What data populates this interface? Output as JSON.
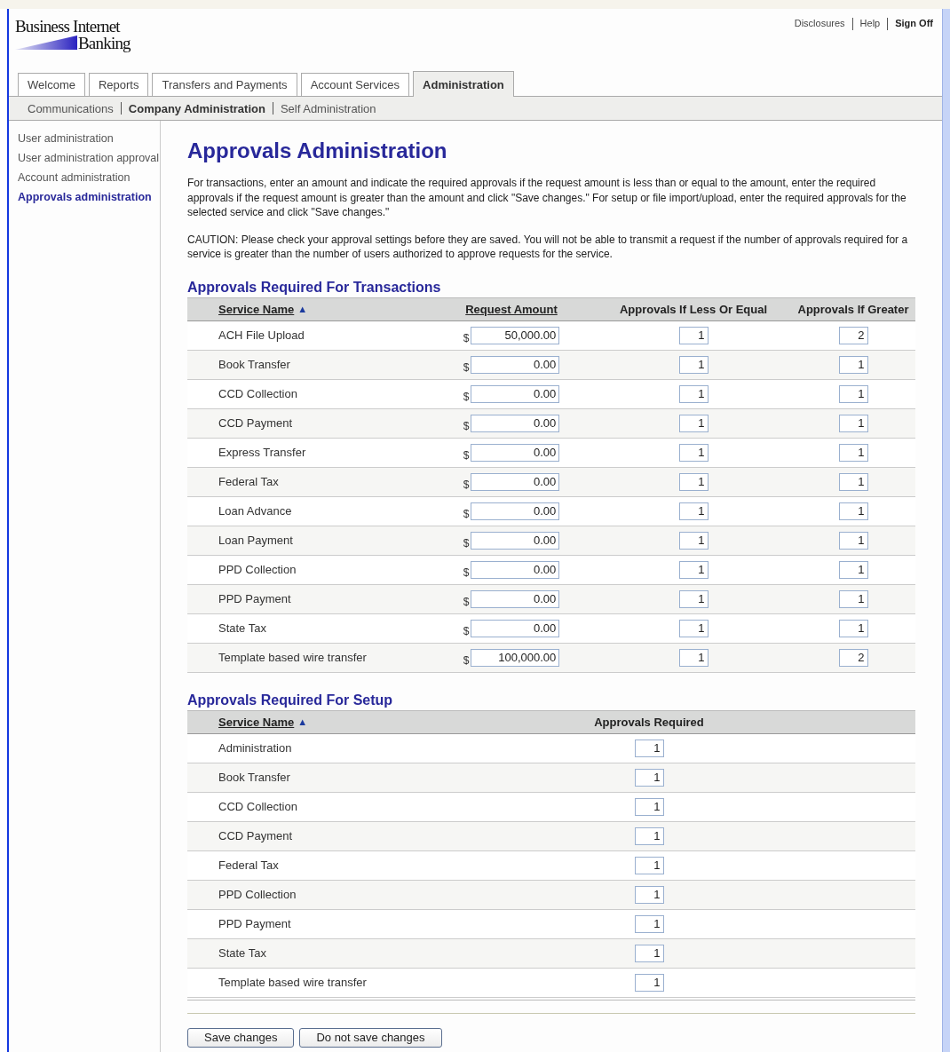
{
  "logo": {
    "line1": "Business Internet",
    "line2": "Banking"
  },
  "utility_links": [
    {
      "label": "Disclosures",
      "bold": false
    },
    {
      "label": "Help",
      "bold": false
    },
    {
      "label": "Sign Off",
      "bold": true
    }
  ],
  "tabs": [
    {
      "label": "Welcome",
      "selected": false
    },
    {
      "label": "Reports",
      "selected": false
    },
    {
      "label": "Transfers and Payments",
      "selected": false
    },
    {
      "label": "Account Services",
      "selected": false
    },
    {
      "label": "Administration",
      "selected": true
    }
  ],
  "subnav": [
    {
      "label": "Communications",
      "selected": false
    },
    {
      "label": "Company Administration",
      "selected": true
    },
    {
      "label": "Self Administration",
      "selected": false
    }
  ],
  "sidebar": {
    "items": [
      {
        "label": "User administration",
        "selected": false
      },
      {
        "label": "User administration approval",
        "selected": false
      },
      {
        "label": "Account administration",
        "selected": false
      },
      {
        "label": "Approvals administration",
        "selected": true
      }
    ]
  },
  "page_title": "Approvals Administration",
  "intro": "For transactions, enter an amount and indicate the required approvals if the request amount is less than or equal to the amount, enter the required approvals if the request amount is greater than the amount and click \"Save changes.\" For setup or file import/upload, enter the required approvals for the selected service and click \"Save changes.\"",
  "caution": "CAUTION: Please check your approval settings before they are saved. You will not be able to transmit a request if the number of approvals required for a service is greater than the number of users authorized to approve requests for the service.",
  "transactions": {
    "title": "Approvals Required For Transactions",
    "columns": [
      {
        "label": "Service Name",
        "sortable": true,
        "sort_indicator": "▲"
      },
      {
        "label": "Request Amount",
        "sortable": true
      },
      {
        "label": "Approvals If Less Or Equal",
        "sortable": false
      },
      {
        "label": "Approvals If Greater",
        "sortable": false
      }
    ],
    "currency": "$",
    "rows": [
      {
        "service": "ACH File Upload",
        "amount": "50,000.00",
        "less_or_equal": "1",
        "greater": "2"
      },
      {
        "service": "Book Transfer",
        "amount": "0.00",
        "less_or_equal": "1",
        "greater": "1"
      },
      {
        "service": "CCD Collection",
        "amount": "0.00",
        "less_or_equal": "1",
        "greater": "1"
      },
      {
        "service": "CCD Payment",
        "amount": "0.00",
        "less_or_equal": "1",
        "greater": "1"
      },
      {
        "service": "Express Transfer",
        "amount": "0.00",
        "less_or_equal": "1",
        "greater": "1"
      },
      {
        "service": "Federal Tax",
        "amount": "0.00",
        "less_or_equal": "1",
        "greater": "1"
      },
      {
        "service": "Loan Advance",
        "amount": "0.00",
        "less_or_equal": "1",
        "greater": "1"
      },
      {
        "service": "Loan Payment",
        "amount": "0.00",
        "less_or_equal": "1",
        "greater": "1"
      },
      {
        "service": "PPD Collection",
        "amount": "0.00",
        "less_or_equal": "1",
        "greater": "1"
      },
      {
        "service": "PPD Payment",
        "amount": "0.00",
        "less_or_equal": "1",
        "greater": "1"
      },
      {
        "service": "State Tax",
        "amount": "0.00",
        "less_or_equal": "1",
        "greater": "1"
      },
      {
        "service": "Template based wire transfer",
        "amount": "100,000.00",
        "less_or_equal": "1",
        "greater": "2"
      }
    ]
  },
  "setup": {
    "title": "Approvals Required For Setup",
    "columns": [
      {
        "label": "Service Name",
        "sortable": true,
        "sort_indicator": "▲"
      },
      {
        "label": "Approvals Required",
        "sortable": false
      }
    ],
    "rows": [
      {
        "service": "Administration",
        "approvals": "1"
      },
      {
        "service": "Book Transfer",
        "approvals": "1"
      },
      {
        "service": "CCD Collection",
        "approvals": "1"
      },
      {
        "service": "CCD Payment",
        "approvals": "1"
      },
      {
        "service": "Federal Tax",
        "approvals": "1"
      },
      {
        "service": "PPD Collection",
        "approvals": "1"
      },
      {
        "service": "PPD Payment",
        "approvals": "1"
      },
      {
        "service": "State Tax",
        "approvals": "1"
      },
      {
        "service": "Template based wire transfer",
        "approvals": "1"
      }
    ]
  },
  "buttons": [
    {
      "label": "Save changes"
    },
    {
      "label": "Do not save changes"
    }
  ]
}
